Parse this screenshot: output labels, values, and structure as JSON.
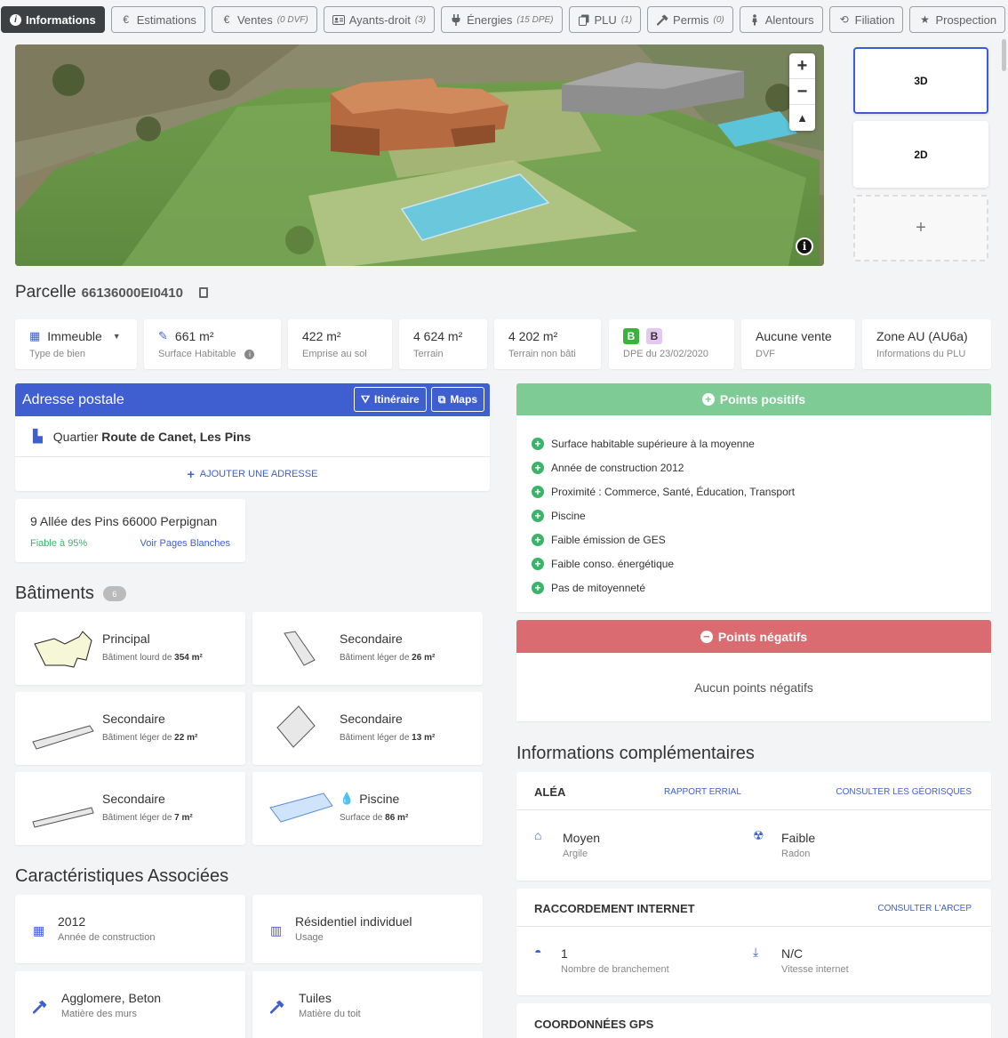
{
  "tabs": [
    {
      "label": "Informations",
      "sub": "",
      "icon": "info-icon"
    },
    {
      "label": "Estimations",
      "sub": "",
      "icon": "euro-icon"
    },
    {
      "label": "Ventes",
      "sub": "(0 DVF)",
      "icon": "euro-icon"
    },
    {
      "label": "Ayants-droit",
      "sub": "(3)",
      "icon": "id-card-icon"
    },
    {
      "label": "Énergies",
      "sub": "(15 DPE)",
      "icon": "plug-icon"
    },
    {
      "label": "PLU",
      "sub": "(1)",
      "icon": "copy-icon"
    },
    {
      "label": "Permis",
      "sub": "(0)",
      "icon": "hammer-icon"
    },
    {
      "label": "Alentours",
      "sub": "",
      "icon": "person-icon"
    },
    {
      "label": "Filiation",
      "sub": "",
      "icon": "history-icon"
    },
    {
      "label": "Prospection",
      "sub": "",
      "icon": "star-icon"
    }
  ],
  "map": {
    "zoom_in": "+",
    "zoom_out": "−",
    "compass": "▲",
    "info": "i"
  },
  "views": {
    "v3d": "3D",
    "v2d": "2D",
    "add": "+"
  },
  "parcelle": {
    "label": "Parcelle",
    "id": "66136000EI0410"
  },
  "stats": {
    "type": {
      "value": "Immeuble",
      "label": "Type de bien"
    },
    "surface": {
      "value": "661 m²",
      "label": "Surface Habitable"
    },
    "emprise": {
      "value": "422 m²",
      "label": "Emprise au sol"
    },
    "terrain": {
      "value": "4 624 m²",
      "label": "Terrain"
    },
    "nonbati": {
      "value": "4 202 m²",
      "label": "Terrain non bâti"
    },
    "dpe": {
      "badge1": "B",
      "badge2": "B",
      "label": "DPE du 23/02/2020",
      "color1": "#3bb33b",
      "color2": "#e3c9f0"
    },
    "dvf": {
      "value": "Aucune vente",
      "label": "DVF"
    },
    "plu": {
      "value": "Zone AU (AU6a)",
      "label": "Informations du PLU"
    }
  },
  "adresse": {
    "title": "Adresse postale",
    "itineraire": "Itinéraire",
    "maps": "Maps",
    "quartier_prefix": "Quartier",
    "quartier": "Route de Canet, Les Pins",
    "add": "AJOUTER UNE ADRESSE",
    "card_address": "9 Allée des Pins 66000 Perpignan",
    "fiable": "Fiable à 95%",
    "pages_blanches": "Voir Pages Blanches"
  },
  "batiments": {
    "title": "Bâtiments",
    "count": "6",
    "items": [
      {
        "type": "Principal",
        "desc": "Bâtiment lourd de",
        "area": "354 m²"
      },
      {
        "type": "Secondaire",
        "desc": "Bâtiment léger de",
        "area": "26 m²"
      },
      {
        "type": "Secondaire",
        "desc": "Bâtiment léger de",
        "area": "22 m²"
      },
      {
        "type": "Secondaire",
        "desc": "Bâtiment léger de",
        "area": "13 m²"
      },
      {
        "type": "Secondaire",
        "desc": "Bâtiment léger de",
        "area": "7 m²"
      },
      {
        "type": "Piscine",
        "desc": "Surface de",
        "area": "86 m²"
      }
    ]
  },
  "caracteristiques": {
    "title": "Caractéristiques Associées",
    "items": [
      {
        "value": "2012",
        "label": "Année de construction",
        "icon": "calendar-icon"
      },
      {
        "value": "Résidentiel individuel",
        "label": "Usage",
        "icon": "building-icon"
      },
      {
        "value": "Agglomere, Beton",
        "label": "Matière des murs",
        "icon": "hammer-icon"
      },
      {
        "value": "Tuiles",
        "label": "Matière du toit",
        "icon": "hammer-icon"
      }
    ]
  },
  "positifs": {
    "title": "Points positifs",
    "items": [
      "Surface habitable supérieure à la moyenne",
      "Année de construction 2012",
      "Proximité : Commerce, Santé, Éducation, Transport",
      "Piscine",
      "Faible émission de GES",
      "Faible conso. énergétique",
      "Pas de mitoyenneté"
    ]
  },
  "negatifs": {
    "title": "Points négatifs",
    "empty": "Aucun points négatifs"
  },
  "infos": {
    "title": "Informations complémentaires",
    "alea": {
      "title": "ALÉA",
      "link1": "RAPPORT ERRIAL",
      "link2": "CONSULTER LES GÉORISQUES",
      "c1": {
        "value": "Moyen",
        "label": "Argile"
      },
      "c2": {
        "value": "Faible",
        "label": "Radon"
      }
    },
    "internet": {
      "title": "RACCORDEMENT INTERNET",
      "link": "CONSULTER L'ARCEP",
      "c1": {
        "value": "1",
        "label": "Nombre de branchement"
      },
      "c2": {
        "value": "N/C",
        "label": "Vitesse internet"
      }
    },
    "gps": {
      "title": "COORDONNÉES GPS"
    }
  }
}
